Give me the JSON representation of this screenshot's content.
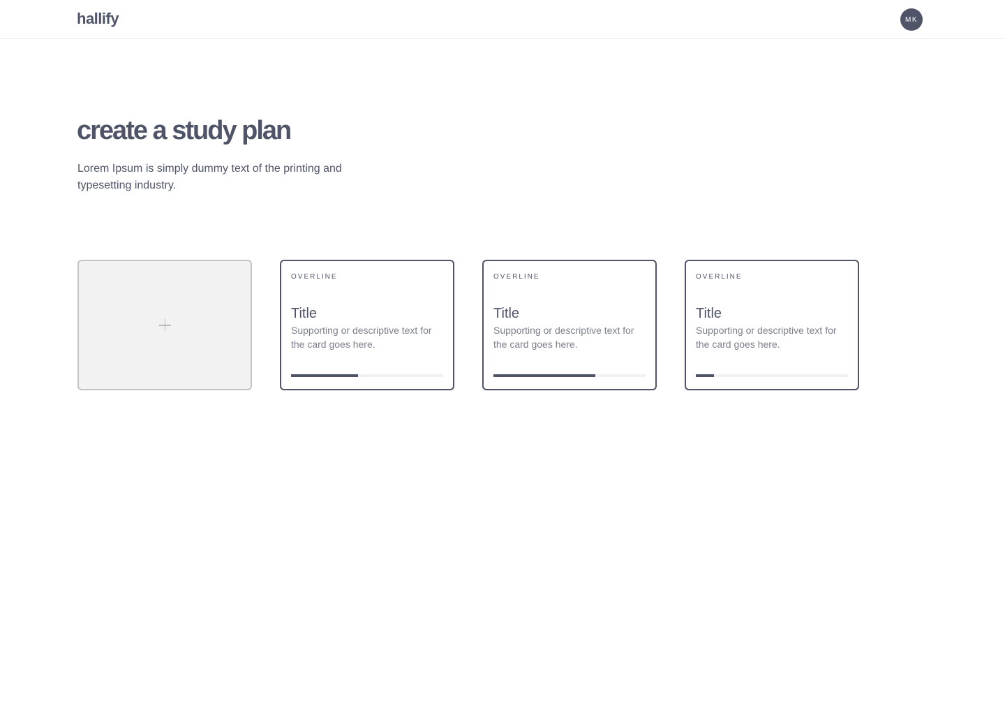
{
  "header": {
    "logo": "hallify",
    "avatar_initials": "MK"
  },
  "hero": {
    "title": "create a study plan",
    "subtitle": "Lorem Ipsum is simply dummy text of the printing and typesetting industry."
  },
  "add_card": {
    "icon": "plus-icon"
  },
  "cards": [
    {
      "overline": "OVERLINE",
      "title": "Title",
      "text": "Supporting or descriptive text for the card goes here.",
      "progress": 0.44
    },
    {
      "overline": "OVERLINE",
      "title": "Title",
      "text": "Supporting or descriptive text for the card goes here.",
      "progress": 0.67
    },
    {
      "overline": "OVERLINE",
      "title": "Title",
      "text": "Supporting or descriptive text for the card goes here.",
      "progress": 0.12
    }
  ],
  "colors": {
    "primary": "#4f5468",
    "muted_text": "#7b7f8c",
    "add_card_bg": "#f2f2f2",
    "track": "#f1f1f2"
  }
}
